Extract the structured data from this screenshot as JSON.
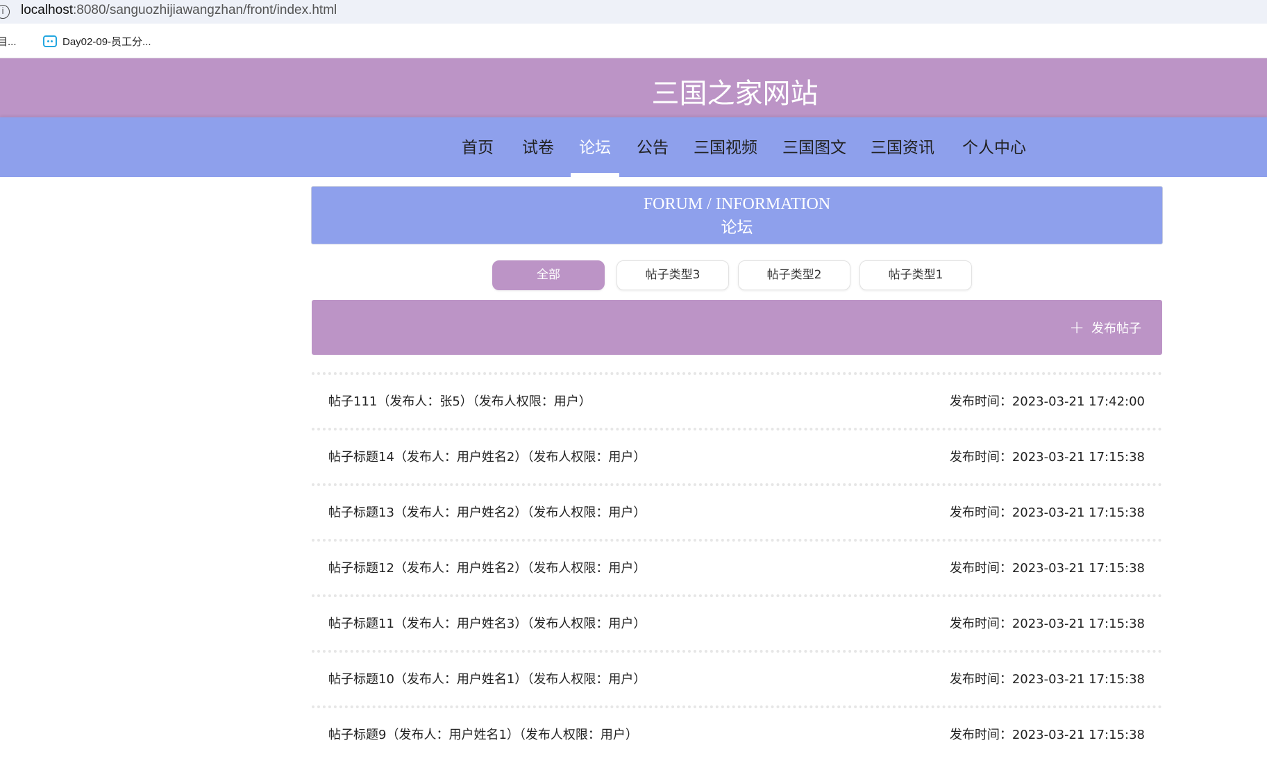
{
  "browser": {
    "url_host": "localhost",
    "url_rest": ":8080/sanguozhijiawangzhan/front/index.html",
    "bookmarks": [
      "目...",
      "Day02-09-员工分..."
    ]
  },
  "site": {
    "title": "三国之家网站"
  },
  "nav": {
    "items": [
      "首页",
      "试卷",
      "论坛",
      "公告",
      "三国视频",
      "三国图文",
      "三国资讯",
      "个人中心"
    ],
    "active": "论坛"
  },
  "banner": {
    "english": "FORUM / INFORMATION",
    "chinese": "论坛"
  },
  "filters": {
    "tabs": [
      "全部",
      "帖子类型3",
      "帖子类型2",
      "帖子类型1"
    ],
    "active": "全部"
  },
  "actions": {
    "publish_label": "发布帖子"
  },
  "posts": [
    {
      "title": "帖子111（发布人：张5）（发布人权限：用户）",
      "time": "发布时间：2023-03-21 17:42:00"
    },
    {
      "title": "帖子标题14（发布人：用户姓名2）（发布人权限：用户）",
      "time": "发布时间：2023-03-21 17:15:38"
    },
    {
      "title": "帖子标题13（发布人：用户姓名2）（发布人权限：用户）",
      "time": "发布时间：2023-03-21 17:15:38"
    },
    {
      "title": "帖子标题12（发布人：用户姓名2）（发布人权限：用户）",
      "time": "发布时间：2023-03-21 17:15:38"
    },
    {
      "title": "帖子标题11（发布人：用户姓名3）（发布人权限：用户）",
      "time": "发布时间：2023-03-21 17:15:38"
    },
    {
      "title": "帖子标题10（发布人：用户姓名1）（发布人权限：用户）",
      "time": "发布时间：2023-03-21 17:15:38"
    },
    {
      "title": "帖子标题9（发布人：用户姓名1）（发布人权限：用户）",
      "time": "发布时间：2023-03-21 17:15:38"
    }
  ],
  "colors": {
    "header_purple": "#bc94c6",
    "nav_blue": "#8ea0ec"
  }
}
